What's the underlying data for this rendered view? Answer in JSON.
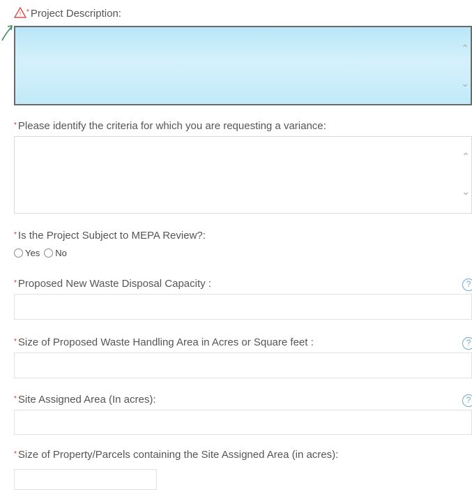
{
  "fields": {
    "project_description": {
      "label": "Project Description:",
      "required_mark": "*"
    },
    "criteria": {
      "label": "Please identify the criteria for which you are requesting a variance:",
      "required_mark": "*"
    },
    "mepa": {
      "label": "Is the Project Subject to MEPA Review?:",
      "required_mark": "*",
      "options": [
        "Yes",
        "No"
      ]
    },
    "waste_capacity": {
      "label": "Proposed New Waste Disposal Capacity :",
      "required_mark": "*",
      "value": ""
    },
    "handling_area": {
      "label": "Size of Proposed Waste Handling Area in Acres or Square feet :",
      "required_mark": "*",
      "value": ""
    },
    "site_assigned": {
      "label": "Site Assigned Area (In acres):",
      "required_mark": "*",
      "value": ""
    },
    "property_size": {
      "label": "Size of Property/Parcels containing the Site Assigned Area (in acres):",
      "required_mark": "*",
      "value": ""
    }
  },
  "icons": {
    "warning": "warning-icon",
    "scroll_up": "chevron-up-icon",
    "scroll_down": "chevron-down-icon",
    "help": "help-icon"
  },
  "colors": {
    "required": "#c0392b",
    "active_field": "#c2eaf8",
    "help": "#6fa8d6",
    "annotation_arrow": "#2e8b57"
  }
}
